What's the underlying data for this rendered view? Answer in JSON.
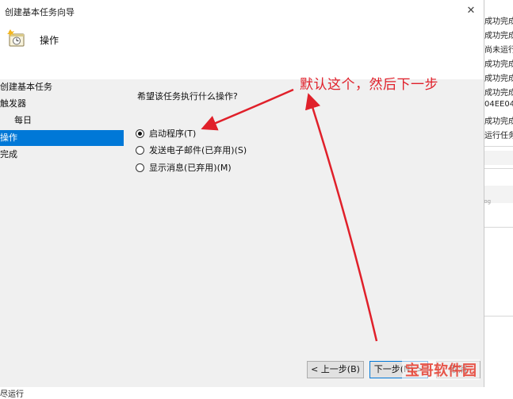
{
  "window": {
    "title": "创建基本任务向导",
    "close_glyph": "✕",
    "header_title": "操作"
  },
  "steps": [
    {
      "label": "创建基本任务"
    },
    {
      "label": "触发器"
    },
    {
      "label": "每日"
    },
    {
      "label": "操作"
    },
    {
      "label": "完成"
    }
  ],
  "content": {
    "prompt": "希望该任务执行什么操作?",
    "options": [
      {
        "label": "启动程序(T)",
        "checked": true
      },
      {
        "label": "发送电子邮件(已弃用)(S)",
        "checked": false
      },
      {
        "label": "显示消息(已弃用)(M)",
        "checked": false
      }
    ]
  },
  "buttons": {
    "back": "< 上一步(B)",
    "next": "下一步(N) >",
    "cancel": "取消"
  },
  "annotation": {
    "text": "默认这个，然后下一步",
    "color": "#e0202a"
  },
  "background_window": {
    "cells": [
      "成功完成",
      "成功完成",
      "尚未运行",
      "成功完成",
      "成功完成",
      "成功完成",
      "04EE04",
      "成功完成",
      "运行任务"
    ],
    "bottom_text": "尽运行"
  },
  "watermark": {
    "text": "宝哥软件园",
    "sub": "csdn@log"
  },
  "icons": {
    "task": "task-scheduler-icon",
    "close": "close-icon"
  }
}
